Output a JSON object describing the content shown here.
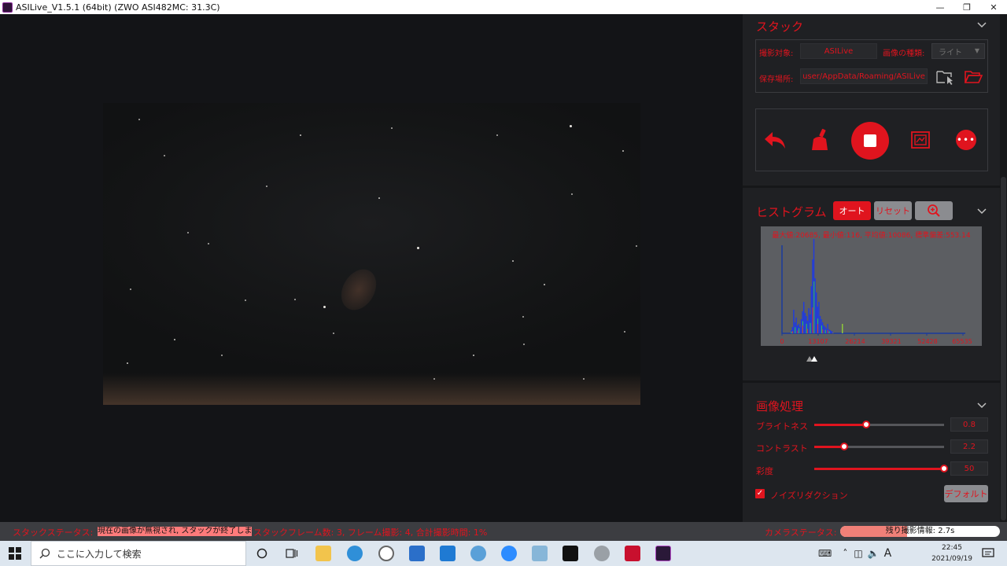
{
  "window": {
    "title": "ASILive_V1.5.1 (64bit)  (ZWO ASI482MC: 31.3C)",
    "minimize": "—",
    "maximize": "❐",
    "close": "✕"
  },
  "stack": {
    "title": "スタック",
    "target_label": "撮影対象:",
    "target_value": "ASILive",
    "type_label": "画像の種類:",
    "type_value": "ライト",
    "save_label": "保存場所:",
    "save_path": "user/AppData/Roaming/ASILive"
  },
  "histogram": {
    "title": "ヒストグラム",
    "auto_label": "オート",
    "reset_label": "リセット",
    "stats": "最大値:20685, 最小値:116, 平均値:10086, 標準偏差:553.14",
    "ticks": [
      "0",
      "13107",
      "26214",
      "39321",
      "52428",
      "65535"
    ]
  },
  "image_processing": {
    "title": "画像処理",
    "brightness_label": "ブライトネス",
    "brightness_value": "0.8",
    "brightness_level": 0.4,
    "contrast_label": "コントラスト",
    "contrast_value": "2.2",
    "contrast_level": 0.23,
    "saturation_label": "彩度",
    "saturation_value": "50",
    "saturation_level": 1.0,
    "noise_label": "ノイズリダクション",
    "default_label": "デフォルト"
  },
  "status": {
    "stack_status_label": "スタックステータス:",
    "stack_status_text": "現在の画像が無視され, スタックが終了しました",
    "stack_info": "スタックフレーム数: 3, フレーム撮影: 4, 合計撮影時間: 1%",
    "camera_status_label": "カメラステータス:",
    "remaining": "残り撮影情報: 2.7s",
    "remaining_level": 0.42
  },
  "taskbar": {
    "search_placeholder": "ここに入力して検索",
    "time": "22:45",
    "date": "2021/09/19",
    "ime": "A"
  },
  "colors": {
    "accent": "#e0141e",
    "panel": "#1f2023",
    "histogram_bg": "#5c5e62"
  }
}
